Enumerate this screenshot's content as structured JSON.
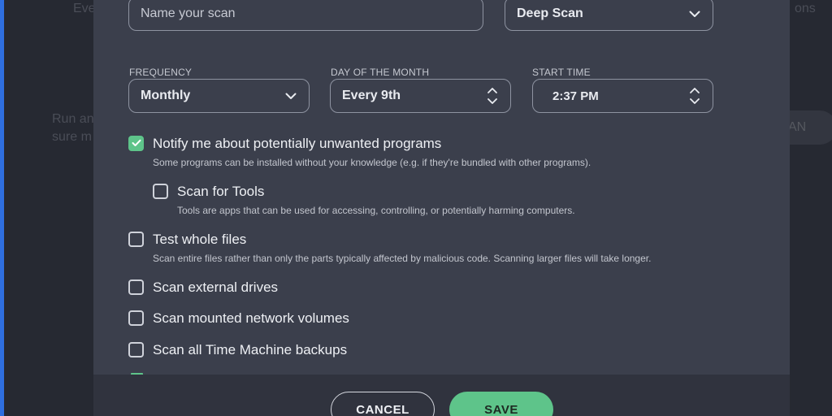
{
  "background": {
    "text_1": "Eve",
    "text_2": "ons",
    "text_3": "Run an",
    "text_4": "sure m",
    "text_5": "AN"
  },
  "form": {
    "name_placeholder": "Name your scan",
    "scan_type": "Deep Scan",
    "frequency_label": "FREQUENCY",
    "frequency_value": "Monthly",
    "day_label": "DAY OF THE MONTH",
    "day_value": "Every 9th",
    "time_label": "START TIME",
    "time_value": "2:37 PM"
  },
  "options": [
    {
      "title": "Notify me about potentially unwanted programs",
      "desc": "Some programs can be installed without your knowledge (e.g. if they're bundled with other programs).",
      "checked": true
    },
    {
      "title": "Scan for Tools",
      "desc": "Tools are apps that can be used for accessing, controlling, or potentially harming computers.",
      "checked": false
    },
    {
      "title": "Test whole files",
      "desc": "Scan entire files rather than only the parts typically affected by malicious code. Scanning larger files will take longer.",
      "checked": false
    },
    {
      "title": "Scan external drives",
      "checked": false
    },
    {
      "title": "Scan mounted network volumes",
      "checked": false
    },
    {
      "title": "Scan all Time Machine backups",
      "checked": false
    }
  ],
  "buttons": {
    "cancel": "CANCEL",
    "save": "SAVE"
  },
  "colors": {
    "accent": "#5ec48a",
    "modal_bg": "#3b3f4c",
    "footer_bg": "#30333e"
  },
  "icons": {
    "dropdown": "chevron-down-icon",
    "stepper": "updown-chevron-icon",
    "checkmark": "checkmark-icon"
  }
}
